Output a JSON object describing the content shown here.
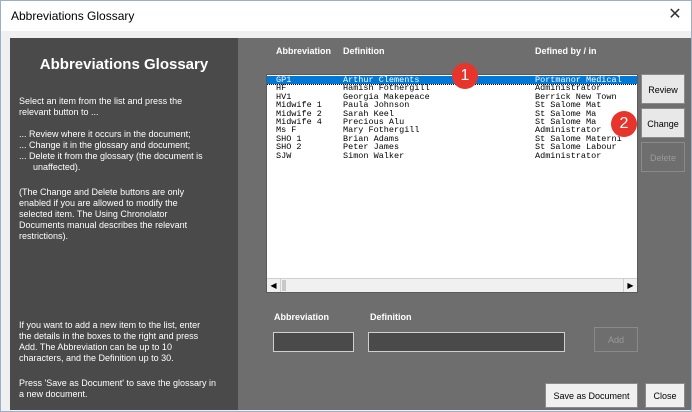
{
  "window": {
    "title": "Abbreviations Glossary",
    "close_label": "✕"
  },
  "left_panel": {
    "heading": "Abbreviations Glossary",
    "intro": [
      "Select an item from the list and press the",
      "relevant button to ..."
    ],
    "bullets": [
      "... Review where it occurs in the document;",
      "... Change it in the glossary and document;",
      "... Delete it from the glossary (the document is",
      "    unaffected)."
    ],
    "note": [
      "(The Change and Delete buttons are only",
      "enabled if you are allowed to modify the",
      "selected item. The Using Chronolator",
      "Documents manual describes the relevant",
      "restrictions)."
    ],
    "add_help": [
      "If you want to add a new item to the list, enter",
      "the details in the boxes to the right and press",
      "Add. The Abbreviation can be up to 10",
      "characters, and the Definition up to 30."
    ],
    "save_help": [
      "Press  'Save as Document' to save the glossary in",
      "a new document."
    ]
  },
  "columns": {
    "abbreviation": "Abbreviation",
    "definition": "Definition",
    "defined_by": "Defined by / in"
  },
  "rows": [
    {
      "abbr": "GP1",
      "definition": "Arthur Clements",
      "defined_by": "Portmanor Medical",
      "selected": true
    },
    {
      "abbr": "HF",
      "definition": "Hamish Fothergill",
      "defined_by": "Administrator",
      "selected": false
    },
    {
      "abbr": "HV1",
      "definition": "Georgia Makepeace",
      "defined_by": "Berrick New Town",
      "selected": false
    },
    {
      "abbr": "Midwife 1",
      "definition": "Paula Johnson",
      "defined_by": "St Salome Mat",
      "selected": false
    },
    {
      "abbr": "Midwife 2",
      "definition": "Sarah Keel",
      "defined_by": "St Salome Ma",
      "selected": false
    },
    {
      "abbr": "Midwife 4",
      "definition": "Precious Alu",
      "defined_by": "St Salome Ma",
      "selected": false
    },
    {
      "abbr": "Ms F",
      "definition": "Mary Fothergill",
      "defined_by": "Administrator",
      "selected": false
    },
    {
      "abbr": "SHO 1",
      "definition": "Brian Adams",
      "defined_by": "St Salome Materni",
      "selected": false
    },
    {
      "abbr": "SHO 2",
      "definition": "Peter James",
      "defined_by": "St Salome Labour",
      "selected": false
    },
    {
      "abbr": "SJW",
      "definition": "Simon Walker",
      "defined_by": "Administrator",
      "selected": false
    }
  ],
  "buttons": {
    "review": "Review",
    "change": "Change",
    "delete": "Delete",
    "add": "Add",
    "save_as_document": "Save as Document",
    "close": "Close"
  },
  "new_item": {
    "abbreviation_label": "Abbreviation",
    "definition_label": "Definition",
    "abbreviation_value": "",
    "definition_value": ""
  },
  "callouts": [
    "1",
    "2"
  ],
  "colors": {
    "left_panel": "#4a4a4a",
    "right_panel": "#6e6e6e",
    "selection": "#0078d7",
    "callout": "#e8352b"
  }
}
